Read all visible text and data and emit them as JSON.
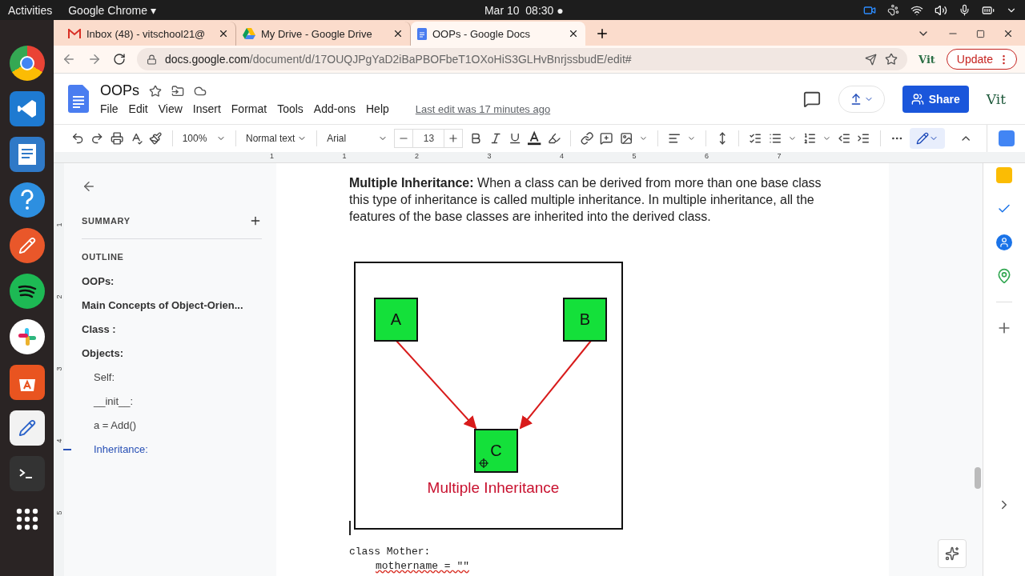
{
  "system_bar": {
    "activities": "Activities",
    "app_name": "Google Chrome",
    "app_caret": "▾",
    "date": "Mar 10",
    "time": "08:30",
    "dot": "●"
  },
  "browser": {
    "tabs": [
      {
        "title": "Inbox (48) - vitschool21@",
        "kind": "mail",
        "selected": false
      },
      {
        "title": "My Drive - Google Drive",
        "kind": "drive",
        "selected": false
      },
      {
        "title": "OOPs - Google Docs",
        "kind": "docs",
        "selected": true
      }
    ],
    "url_host": "docs.google.com",
    "url_path": "/document/d/17OUQJPgYaD2iBaPBOFbeT1OXoHiS3GLHvBnrjssbudE/edit#",
    "profile": "Vit",
    "update_button": "Update"
  },
  "docs": {
    "title": "OOPs",
    "menu": [
      "File",
      "Edit",
      "View",
      "Insert",
      "Format",
      "Tools",
      "Add-ons",
      "Help"
    ],
    "last_edit": "Last edit was 17 minutes ago",
    "share_button": "Share",
    "account": "Vit",
    "toolbar": {
      "zoom": "100%",
      "style": "Normal text",
      "font": "Arial",
      "font_size": "13"
    },
    "ruler": [
      "1",
      "1",
      "2",
      "3",
      "4",
      "5",
      "6",
      "7"
    ],
    "vertical_ruler": [
      "1",
      "2",
      "3",
      "4",
      "5"
    ]
  },
  "outline_panel": {
    "summary_label": "SUMMARY",
    "outline_label": "OUTLINE",
    "items": [
      {
        "text": "OOPs:",
        "selected": false
      },
      {
        "text": "Main Concepts of Object-Orien...",
        "selected": false
      },
      {
        "text": "Class :",
        "selected": false
      },
      {
        "text": "Objects:",
        "selected": false,
        "children": [
          {
            "text": "Self:",
            "selected": false
          },
          {
            "text": "__init__:",
            "selected": false
          },
          {
            "text": "a = Add()",
            "selected": false
          },
          {
            "text": "Inheritance:",
            "selected": true
          }
        ]
      }
    ]
  },
  "document": {
    "paragraph": "**Multiple Inheritance:** When a class can be derived from more than one base class this type of inheritance is called multiple inheritance. In multiple inheritance, all the features of the base classes are inherited into the derived class.",
    "diagram": {
      "nodes": [
        "A",
        "B",
        "C"
      ],
      "caption": "Multiple Inheritance"
    },
    "code": [
      {
        "text": "class Mother:",
        "misspelled": false,
        "children": [
          {
            "text": "mothername = \"\"",
            "misspelled": true
          }
        ]
      }
    ]
  }
}
